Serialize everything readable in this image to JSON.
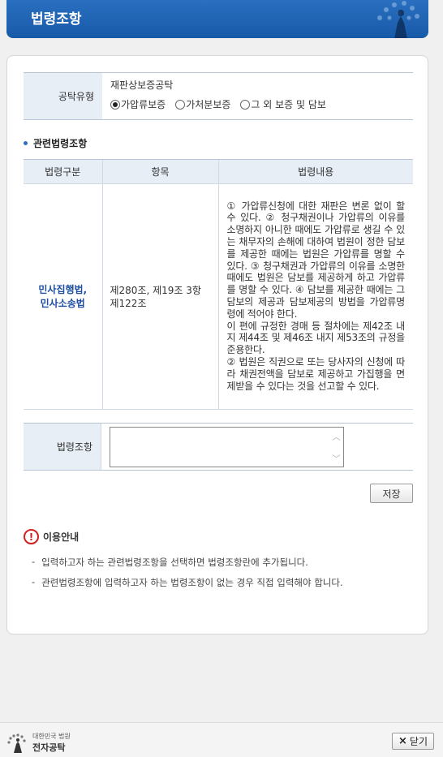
{
  "window": {
    "title": "법령조항"
  },
  "form": {
    "deposit_type_label": "공탁유형",
    "deposit_type_value": "재판상보증공탁",
    "options": [
      {
        "label": "가압류보증",
        "selected": true
      },
      {
        "label": "가처분보증",
        "selected": false
      },
      {
        "label": "그 외 보증 및 담보",
        "selected": false
      }
    ]
  },
  "section_title": "관련법령조항",
  "table": {
    "headers": [
      "법령구분",
      "항목",
      "법령내용"
    ],
    "rows": [
      {
        "category_line1": "민사집행법,",
        "category_line2": "민사소송법",
        "item_line1": "제280조, 제19조 3항",
        "item_line2": "제122조",
        "content_p1": "① 가압류신청에 대한 재판은 변론 없이 할 수 있다. ② 청구채권이나 가압류의 이유를 소명하지 아니한 때에도 가압류로 생길 수 있는 채무자의 손해에 대하여 법원이 정한 담보를 제공한 때에는 법원은 가압류를 명할 수 있다. ③ 청구채권과 가압류의 이유를 소명한 때에도 법원은 담보를 제공하게 하고 가압류를 명할 수 있다. ④ 담보를 제공한 때에는 그 담보의 제공과 담보제공의 방법을 가압류명령에 적어야 한다.",
        "content_p2": "이 편에 규정한 경매 등 절차에는 제42조 내지 제44조 및 제46조 내지 제53조의 규정을 준용한다.",
        "content_p3": "② 법원은 직권으로 또는 당사자의 신청에 따라 채권전액을 담보로 제공하고 가집행을 면제받을 수 있다는 것을 선고할 수 있다."
      }
    ]
  },
  "law_clause": {
    "label": "법령조항",
    "value": ""
  },
  "buttons": {
    "save": "저장",
    "close": "닫기"
  },
  "notice": {
    "title": "이용안내",
    "items": [
      "입력하고자 하는 관련법령조항을 선택하면 법령조항란에 추가됩니다.",
      "관련법령조항에 입력하고자 하는 법령조항이 없는 경우 직접 입력해야 합니다."
    ]
  },
  "footer": {
    "logo_small": "대한민국 법원",
    "logo_big": "전자공탁"
  },
  "colors": {
    "title_bar": "#1c62b3",
    "label_bg": "#e7eef6",
    "category_text": "#1f4fa0",
    "notice_icon": "#d02020"
  }
}
